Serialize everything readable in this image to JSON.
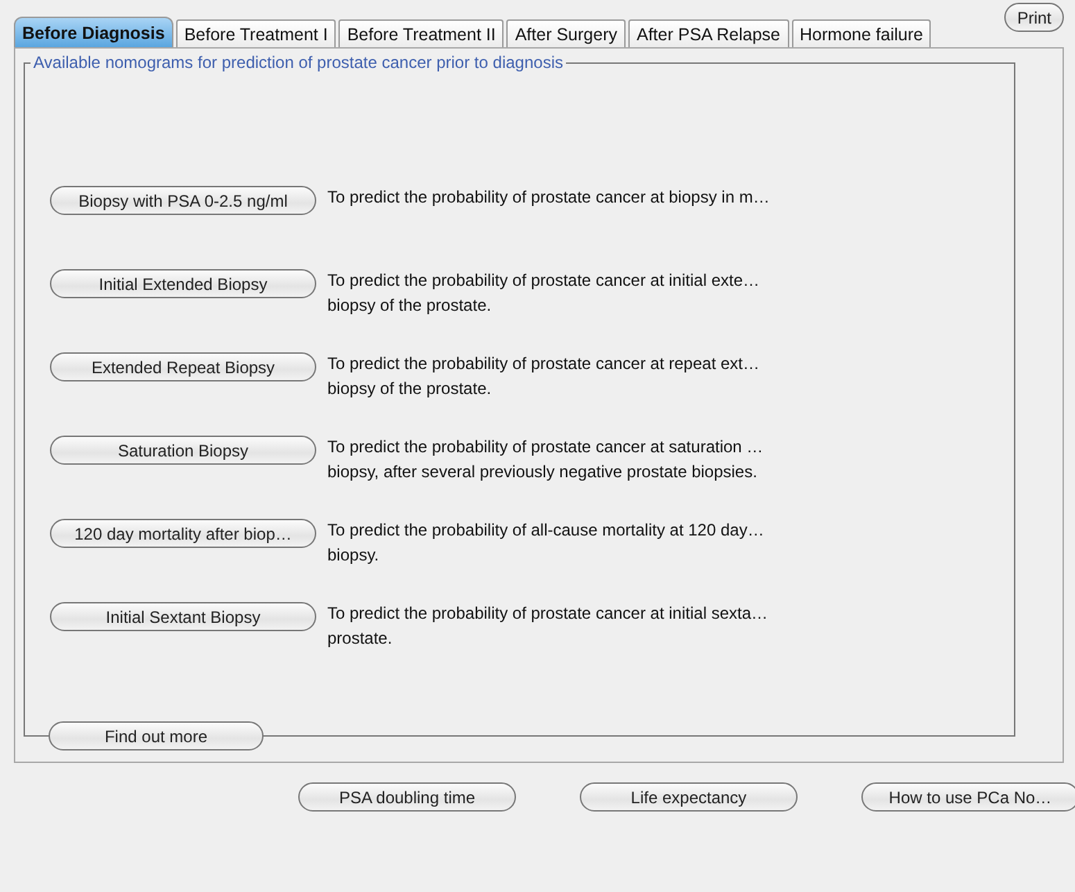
{
  "tabs": [
    {
      "label": "Before Diagnosis",
      "selected": true
    },
    {
      "label": "Before Treatment I",
      "selected": false
    },
    {
      "label": "Before Treatment II",
      "selected": false
    },
    {
      "label": "After Surgery",
      "selected": false
    },
    {
      "label": "After PSA Relapse",
      "selected": false
    },
    {
      "label": "Hormone failure",
      "selected": false
    }
  ],
  "print_button": "Print",
  "group": {
    "title": "Available nomograms for prediction of prostate cancer prior to diagnosis",
    "nomograms": [
      {
        "button": "Biopsy with PSA 0-2.5 ng/ml",
        "description": [
          "To predict the probability of prostate cancer at biopsy in m…"
        ]
      },
      {
        "button": "Initial Extended Biopsy",
        "description": [
          "To predict the probability of prostate cancer at initial exte…",
          "biopsy of the prostate."
        ]
      },
      {
        "button": "Extended Repeat Biopsy",
        "description": [
          "To predict the probability of prostate cancer at repeat ext…",
          "biopsy of the prostate."
        ]
      },
      {
        "button": "Saturation Biopsy",
        "description": [
          "To predict the probability of prostate cancer at saturation …",
          "biopsy, after several previously negative prostate biopsies."
        ]
      },
      {
        "button": "120 day mortality after biop…",
        "description": [
          "To predict the probability of all-cause mortality at 120 day…",
          "biopsy."
        ]
      },
      {
        "button": "Initial Sextant Biopsy",
        "description": [
          "To predict the probability of prostate cancer at initial sexta…",
          "prostate."
        ]
      }
    ]
  },
  "find_out_more_button": "Find out more",
  "bottom_buttons": [
    "PSA doubling time",
    "Life expectancy",
    "How to use PCa No…"
  ]
}
